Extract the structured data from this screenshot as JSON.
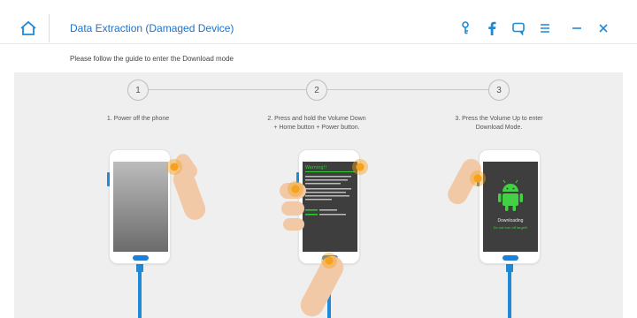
{
  "window": {
    "title": "Data Extraction (Damaged Device)",
    "icons": [
      "home-icon",
      "key-icon",
      "facebook-icon",
      "feedback-icon",
      "menu-icon",
      "minimize-icon",
      "close-icon"
    ]
  },
  "guide": {
    "instruction": "Please follow the guide to enter the Download mode"
  },
  "steps": [
    {
      "number": "1",
      "text": "1. Power off the phone"
    },
    {
      "number": "2",
      "text_line1": "2. Press and hold the Volume Down",
      "text_line2": "+ Home button + Power button."
    },
    {
      "number": "3",
      "text_line1": "3. Press the Volume Up to enter",
      "text_line2": "Download Mode."
    }
  ],
  "phone2_screen": {
    "heading": "Warning!!"
  },
  "phone3_screen": {
    "status": "Downloading",
    "note": "Do not turn off target!!"
  },
  "colors": {
    "accent": "#1e8ad6",
    "background": "#efefef",
    "press_marker": "#f7a21e",
    "android_green": "#44d044"
  }
}
